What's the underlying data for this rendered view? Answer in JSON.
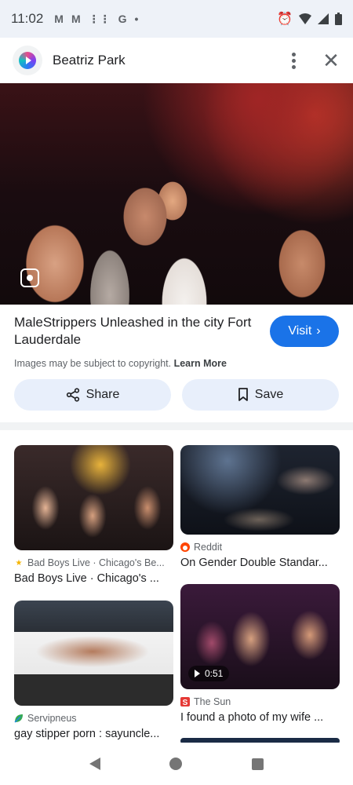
{
  "status_bar": {
    "time": "11:02",
    "left_icons": [
      "gmail-icon",
      "gmail-icon",
      "grid-icon",
      "google-icon",
      "dot-icon"
    ],
    "right_icons": [
      "alarm-icon",
      "wifi-icon",
      "signal-icon",
      "battery-icon"
    ]
  },
  "header": {
    "source_name": "Beatriz Park",
    "more_icon": "more-vert-icon",
    "close_icon": "close-icon"
  },
  "result": {
    "title": "MaleStrippers Unleashed in the city Fort Lauderdale",
    "visit_label": "Visit",
    "copyright_text": "Images may be subject to copyright.",
    "learn_more": "Learn More",
    "share_label": "Share",
    "save_label": "Save"
  },
  "related": [
    {
      "source": "Bad Boys Live · Chicago's Be...",
      "title": "Bad Boys Live · Chicago's ...",
      "favicon": "star-icon",
      "favicon_color": "#f4b400"
    },
    {
      "source": "Reddit",
      "title": "On Gender Double Standar...",
      "favicon": "reddit-icon",
      "favicon_color": "#ff4500"
    },
    {
      "source": "Servipneus",
      "title": "gay stipper porn : sayuncle...",
      "favicon": "leaf-icon",
      "favicon_color": "#34a853"
    },
    {
      "source": "The Sun",
      "title": "I found a photo of my wife ...",
      "favicon": "sun-icon",
      "favicon_color": "#e53935",
      "duration": "0:51"
    }
  ],
  "colors": {
    "accent": "#1a73e8",
    "action_bg": "#e8effb",
    "status_bg": "#eef2f8"
  }
}
